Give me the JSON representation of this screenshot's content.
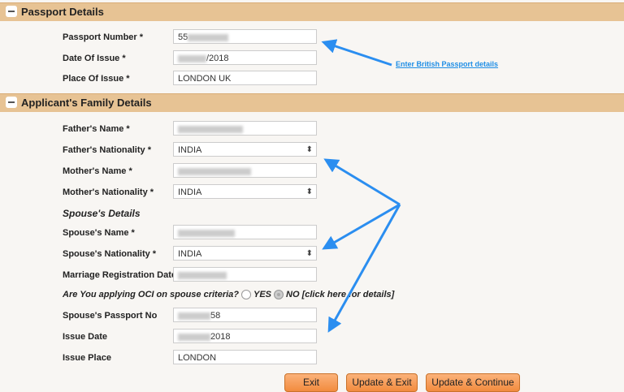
{
  "passport": {
    "title": "Passport Details",
    "fields": [
      {
        "label": "Passport Number *",
        "value": "55"
      },
      {
        "label": "Date Of Issue *",
        "value": "/2018"
      },
      {
        "label": "Place Of Issue *",
        "value": "LONDON UK"
      }
    ]
  },
  "annotation": "Enter British Passport details",
  "family": {
    "title": "Applicant's Family Details",
    "fields": [
      {
        "label": "Father's Name *",
        "value": ""
      },
      {
        "label": "Father's Nationality *",
        "value": "INDIA"
      },
      {
        "label": "Mother's Name *",
        "value": ""
      },
      {
        "label": "Mother's Nationality *",
        "value": "INDIA"
      }
    ]
  },
  "spouse": {
    "heading": "Spouse's Details",
    "fields": [
      {
        "label": "Spouse's Name *",
        "value": ""
      },
      {
        "label": "Spouse's Nationality *",
        "value": "INDIA"
      },
      {
        "label": "Marriage Registration Date",
        "value": ""
      }
    ],
    "question": "Are You applying OCI on spouse criteria?",
    "yes": "YES",
    "no": "NO [click here for details]",
    "selected": "NO",
    "passport_fields": [
      {
        "label": "Spouse's Passport No",
        "value": "58"
      },
      {
        "label": "Issue Date",
        "value": "2018"
      },
      {
        "label": "Issue Place",
        "value": "LONDON"
      }
    ]
  },
  "buttons": {
    "exit": "Exit",
    "update_exit": "Update & Exit",
    "update_continue": "Update & Continue"
  },
  "colors": {
    "header": "#e7c394",
    "button": "#f28b3e",
    "arrow": "#2b8ef0"
  }
}
